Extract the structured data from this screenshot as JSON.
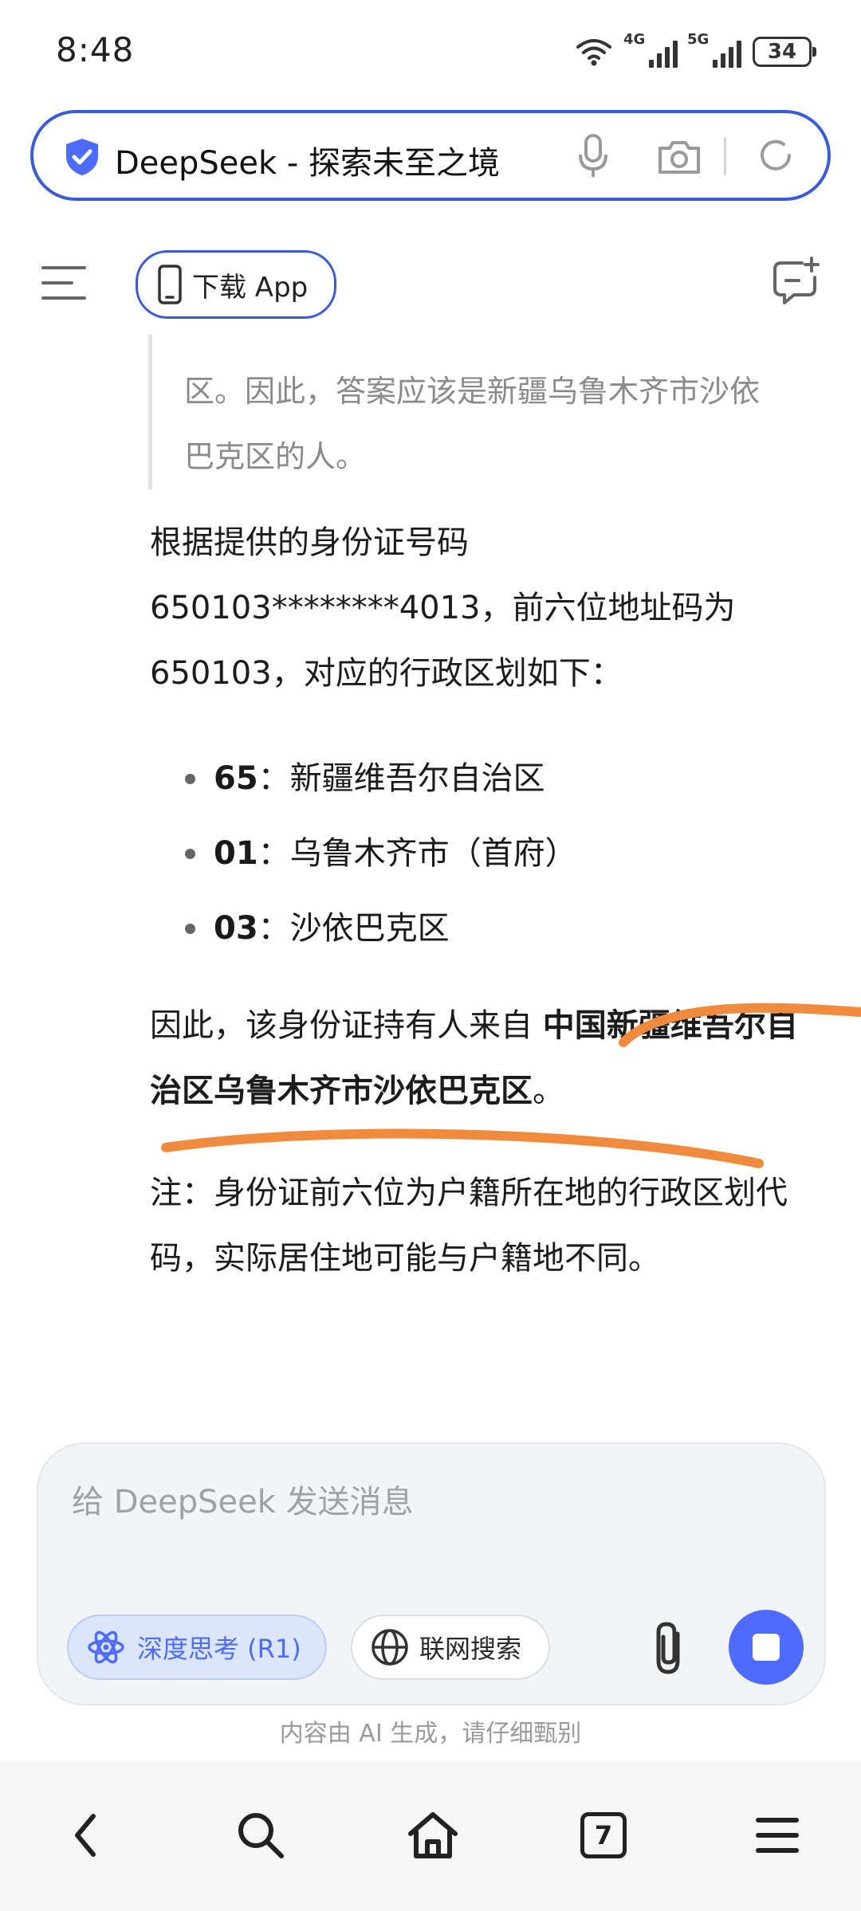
{
  "status_bar": {
    "time": "8:48",
    "network_1": "4G",
    "network_2": "5G",
    "battery": "34"
  },
  "address_bar": {
    "title": "DeepSeek - 探索未至之境"
  },
  "toolbar": {
    "download_label": "下载 App"
  },
  "chat": {
    "quote_lines": [
      "区。因此，答案应该是新疆乌鲁木齐市沙依",
      "巴克区的人。"
    ],
    "para1": "根据提供的身份证号码650103********4013，前六位地址码为650103，对应的行政区划如下：",
    "bullets": [
      {
        "code": "65",
        "sep": "：",
        "text": "新疆维吾尔自治区"
      },
      {
        "code": "01",
        "sep": "：",
        "text": "乌鲁木齐市（首府）"
      },
      {
        "code": "03",
        "sep": "：",
        "text": "沙依巴克区"
      }
    ],
    "para2_prefix": "因此，该身份证持有人来自 ",
    "para2_bold": "中国新疆维吾尔自治区乌鲁木齐市沙依巴克区",
    "para2_suffix": "。",
    "para3": "注：身份证前六位为户籍所在地的行政区划代码，实际居住地可能与户籍地不同。"
  },
  "input": {
    "placeholder": "给 DeepSeek 发送消息",
    "deep_think_label": "深度思考 (R1)",
    "web_search_label": "联网搜索"
  },
  "disclaimer": "内容由 AI 生成，请仔细甄别",
  "bottom_nav": {
    "tabs_count": "7"
  },
  "colors": {
    "accent": "#4d6bfe",
    "address_border": "#3a5bd9",
    "annotation": "#f08a3c"
  }
}
